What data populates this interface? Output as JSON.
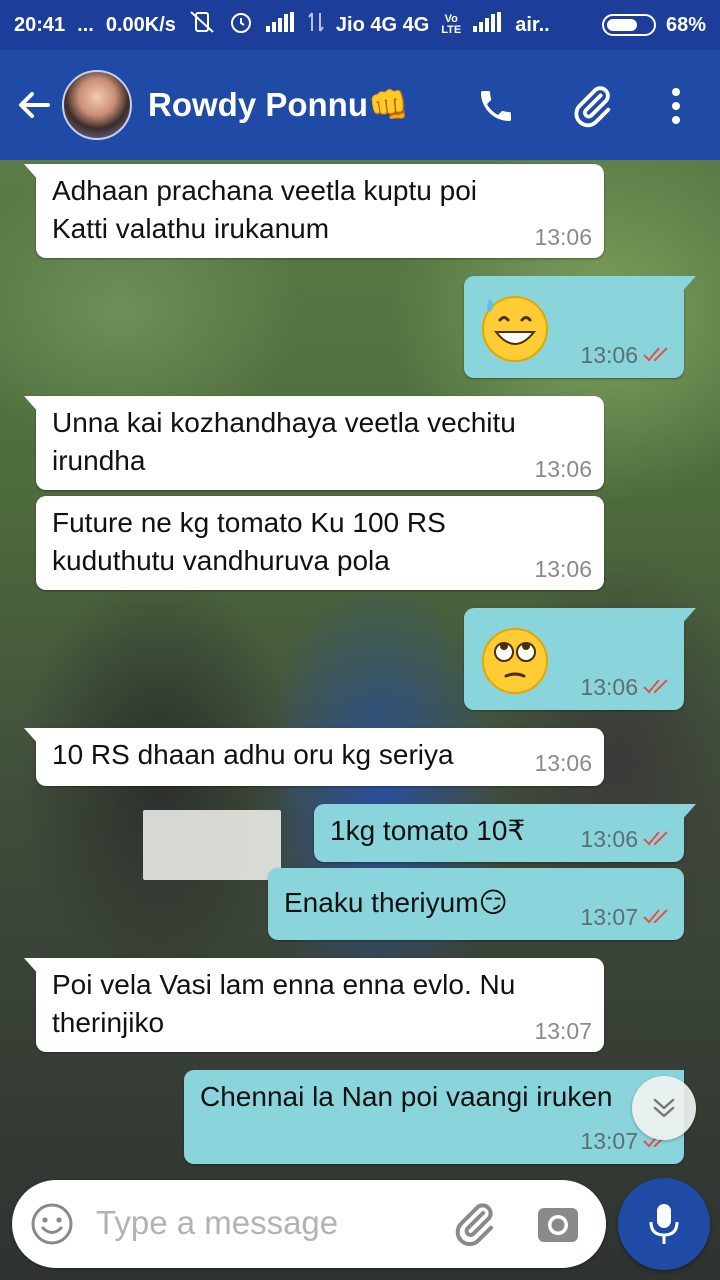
{
  "status_bar": {
    "time": "20:41",
    "dots": "...",
    "speed": "0.00K/s",
    "carrier1": "Jio 4G 4G",
    "carrier2": "air..",
    "battery": "68%",
    "battery_level_percent": 68
  },
  "header": {
    "contact_name": "Rowdy Ponnu👊"
  },
  "colors": {
    "app_bar": "#1f4aa5",
    "incoming_bubble": "#ffffff",
    "outgoing_bubble": "#8ad5db",
    "read_ticks": "#e0534a"
  },
  "messages": [
    {
      "direction": "in",
      "lines": [
        "Adhaan prachana veetla kuptu poi",
        "Katti valathu irukanum"
      ],
      "time": "13:06"
    },
    {
      "direction": "out",
      "emoji": "grinning-face-with-sweat",
      "time": "13:06",
      "status": "read"
    },
    {
      "direction": "in",
      "lines": [
        "Unna kai kozhandhaya veetla vechitu",
        "irundha"
      ],
      "time": "13:06"
    },
    {
      "direction": "in",
      "lines": [
        "Future ne kg tomato Ku 100 RS",
        "kuduthutu vandhuruva pola"
      ],
      "time": "13:06"
    },
    {
      "direction": "out",
      "emoji": "face-with-rolling-eyes",
      "time": "13:06",
      "status": "read"
    },
    {
      "direction": "in",
      "lines": [
        "10 RS dhaan adhu oru kg seriya"
      ],
      "time": "13:06"
    },
    {
      "direction": "out",
      "lines": [
        "1kg tomato 10₹"
      ],
      "time": "13:06",
      "status": "read"
    },
    {
      "direction": "out",
      "lines": [
        "Enaku theriyum😏"
      ],
      "time": "13:07",
      "status": "read"
    },
    {
      "direction": "in",
      "lines": [
        "Poi vela Vasi lam enna enna evlo. Nu",
        "therinjiko"
      ],
      "time": "13:07"
    },
    {
      "direction": "out",
      "lines": [
        "Chennai la Nan poi vaangi iruken"
      ],
      "time": "13:07",
      "status": "read"
    }
  ],
  "composer": {
    "placeholder": "Type a message"
  },
  "icons": {
    "back": "back-arrow-icon",
    "call": "phone-icon",
    "attach": "paperclip-icon",
    "menu": "more-vert-icon",
    "emoji": "emoji-icon",
    "camera": "camera-icon",
    "mic": "mic-icon",
    "scroll": "double-chevron-down-icon"
  }
}
